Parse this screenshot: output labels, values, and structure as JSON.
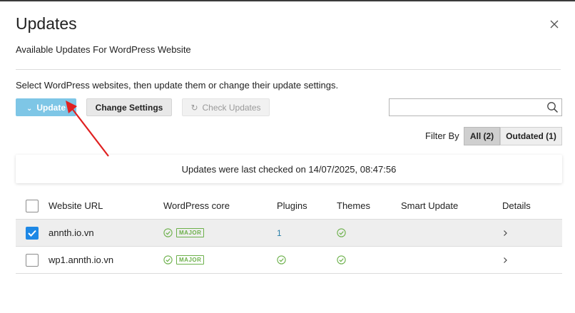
{
  "dialog": {
    "title": "Updates",
    "subtitle": "Available Updates For WordPress Website",
    "instructions": "Select WordPress websites, then update them or change their update settings."
  },
  "toolbar": {
    "update_label": "Update",
    "change_settings_label": "Change Settings",
    "check_updates_label": "Check Updates",
    "search_placeholder": ""
  },
  "filter": {
    "label": "Filter By",
    "options": [
      "All (2)",
      "Outdated (1)"
    ],
    "selected": "All (2)"
  },
  "notice": "Updates were last checked on 14/07/2025, 08:47:56",
  "table": {
    "headers": {
      "url": "Website URL",
      "core": "WordPress core",
      "plugins": "Plugins",
      "themes": "Themes",
      "smart": "Smart Update",
      "details": "Details"
    },
    "rows": [
      {
        "url": "annth.io.vn",
        "core_badge": "MAJOR",
        "plugins": "1",
        "checked": true
      },
      {
        "url": "wp1.annth.io.vn",
        "core_badge": "MAJOR",
        "plugins": "",
        "checked": false
      }
    ]
  },
  "colors": {
    "update_button": "#7ec6e6",
    "ok_green": "#6cb04a",
    "checkbox_blue": "#1e88e5",
    "annotation_arrow": "#e02020",
    "link": "#2a7fa8"
  }
}
